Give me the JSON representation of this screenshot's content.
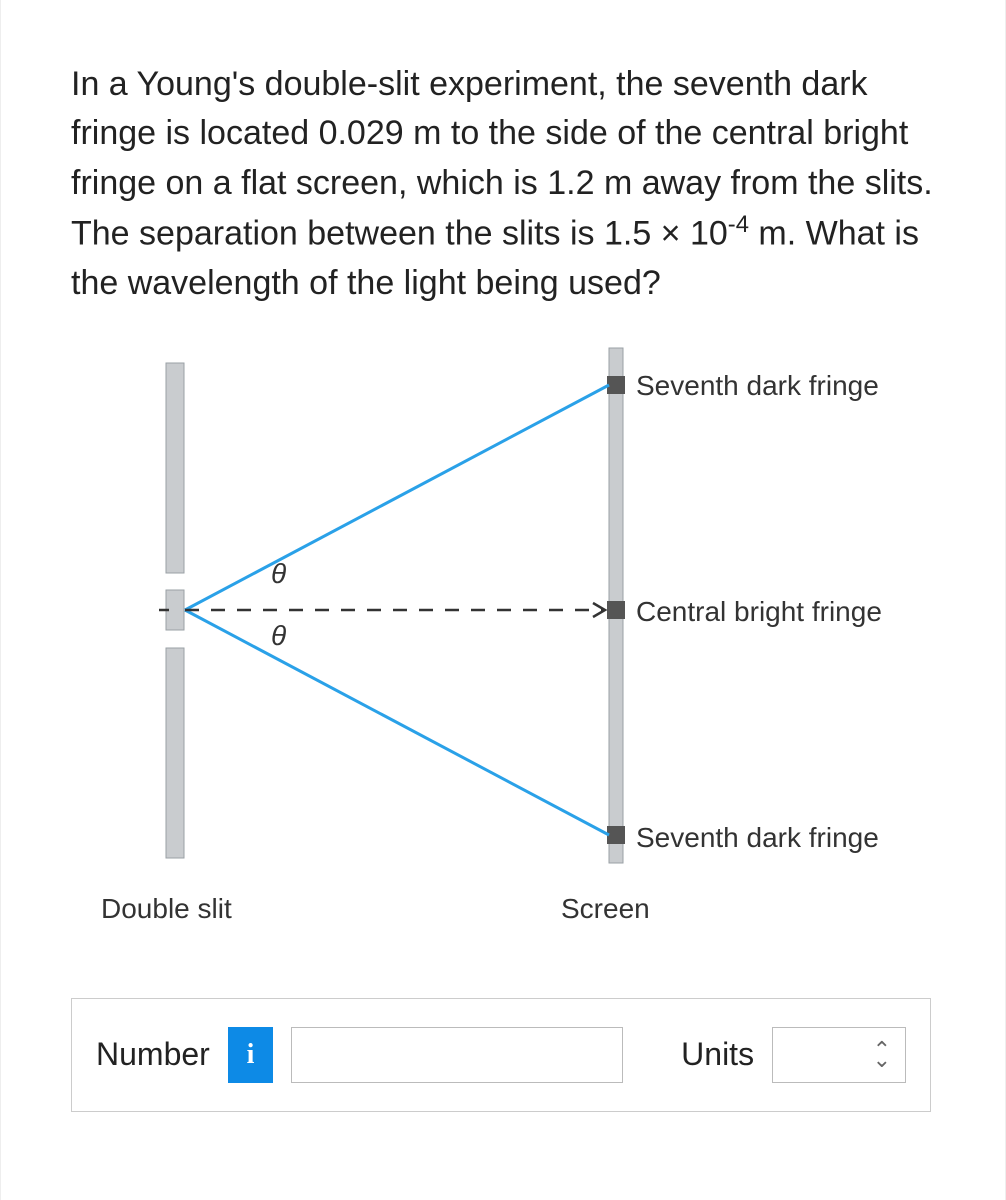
{
  "question": {
    "text_parts": {
      "p1": "In a Young's double-slit experiment, the seventh dark fringe is located 0.029 m to the side of the central bright fringe on a flat screen, which is 1.2 m away from the slits. The separation between the slits is 1.5 × 10",
      "exp": "-4",
      "p2": " m. What is the wavelength of the light being used?"
    }
  },
  "diagram": {
    "label_top_fringe": "Seventh dark fringe",
    "label_central": "Central bright fringe",
    "label_bottom_fringe": "Seventh dark fringe",
    "label_double_slit": "Double slit",
    "label_screen": "Screen",
    "theta_top": "θ",
    "theta_bottom": "θ"
  },
  "answer": {
    "number_label": "Number",
    "info_badge": "i",
    "number_value": "",
    "number_placeholder": "",
    "units_label": "Units",
    "units_value": ""
  }
}
